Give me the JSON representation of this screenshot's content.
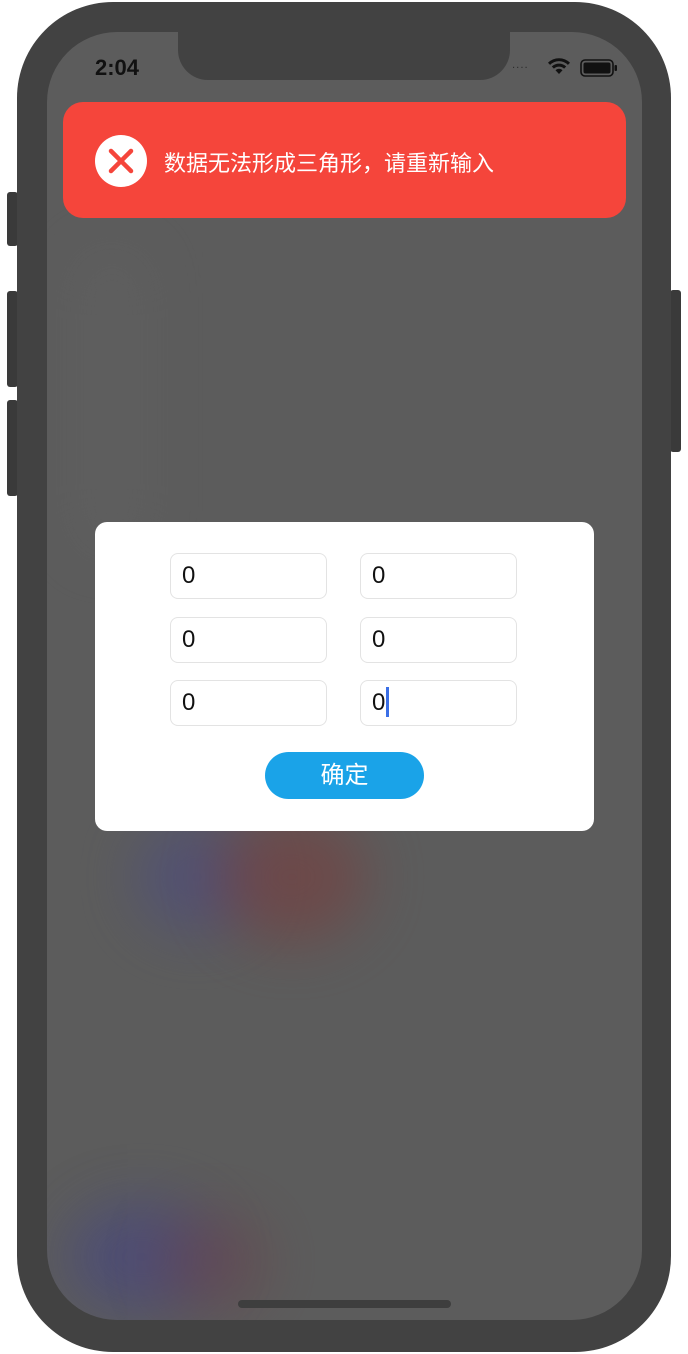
{
  "status_bar": {
    "time": "2:04",
    "signal_dots": "....",
    "wifi_icon": "wifi-icon",
    "battery_icon": "battery-icon"
  },
  "toast": {
    "icon": "close-circle-icon",
    "message": "数据无法形成三角形，请重新输入",
    "background_color": "#f5453b"
  },
  "dialog": {
    "fields": [
      {
        "value": "0"
      },
      {
        "value": "0"
      },
      {
        "value": "0"
      },
      {
        "value": "0"
      },
      {
        "value": "0"
      },
      {
        "value": "0",
        "focused": true
      }
    ],
    "confirm_label": "确定",
    "confirm_color": "#1aa3e8"
  }
}
